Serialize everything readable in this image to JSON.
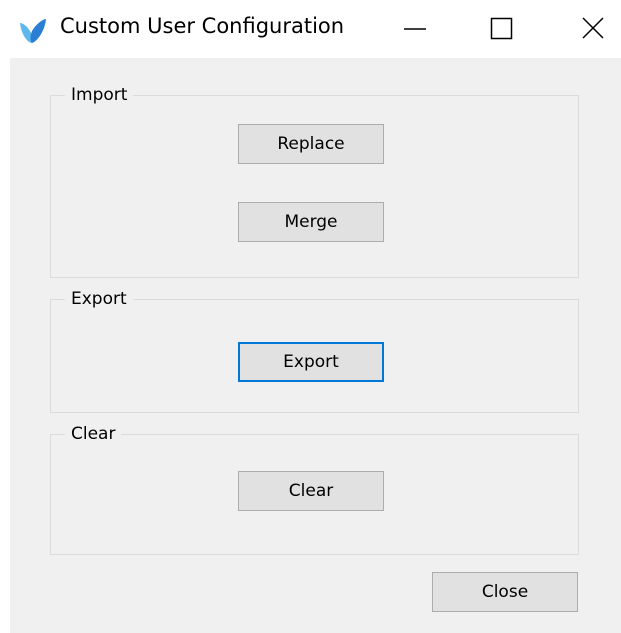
{
  "window": {
    "title": "Custom User Configuration",
    "icon": "app-logo-icon",
    "controls": {
      "minimize_icon": "minimize-icon",
      "maximize_icon": "maximize-icon",
      "close_icon": "close-icon"
    }
  },
  "groups": {
    "import": {
      "label": "Import",
      "replace_label": "Replace",
      "merge_label": "Merge"
    },
    "export": {
      "label": "Export",
      "export_label": "Export",
      "export_focused": true
    },
    "clear": {
      "label": "Clear",
      "clear_label": "Clear"
    }
  },
  "footer": {
    "close_label": "Close"
  },
  "colors": {
    "client_background": "#f0f0f0",
    "button_background": "#e1e1e1",
    "button_border": "#adadad",
    "focus_border": "#0078d7",
    "logo_primary": "#2a7fd4",
    "logo_secondary": "#5fb8ec"
  }
}
